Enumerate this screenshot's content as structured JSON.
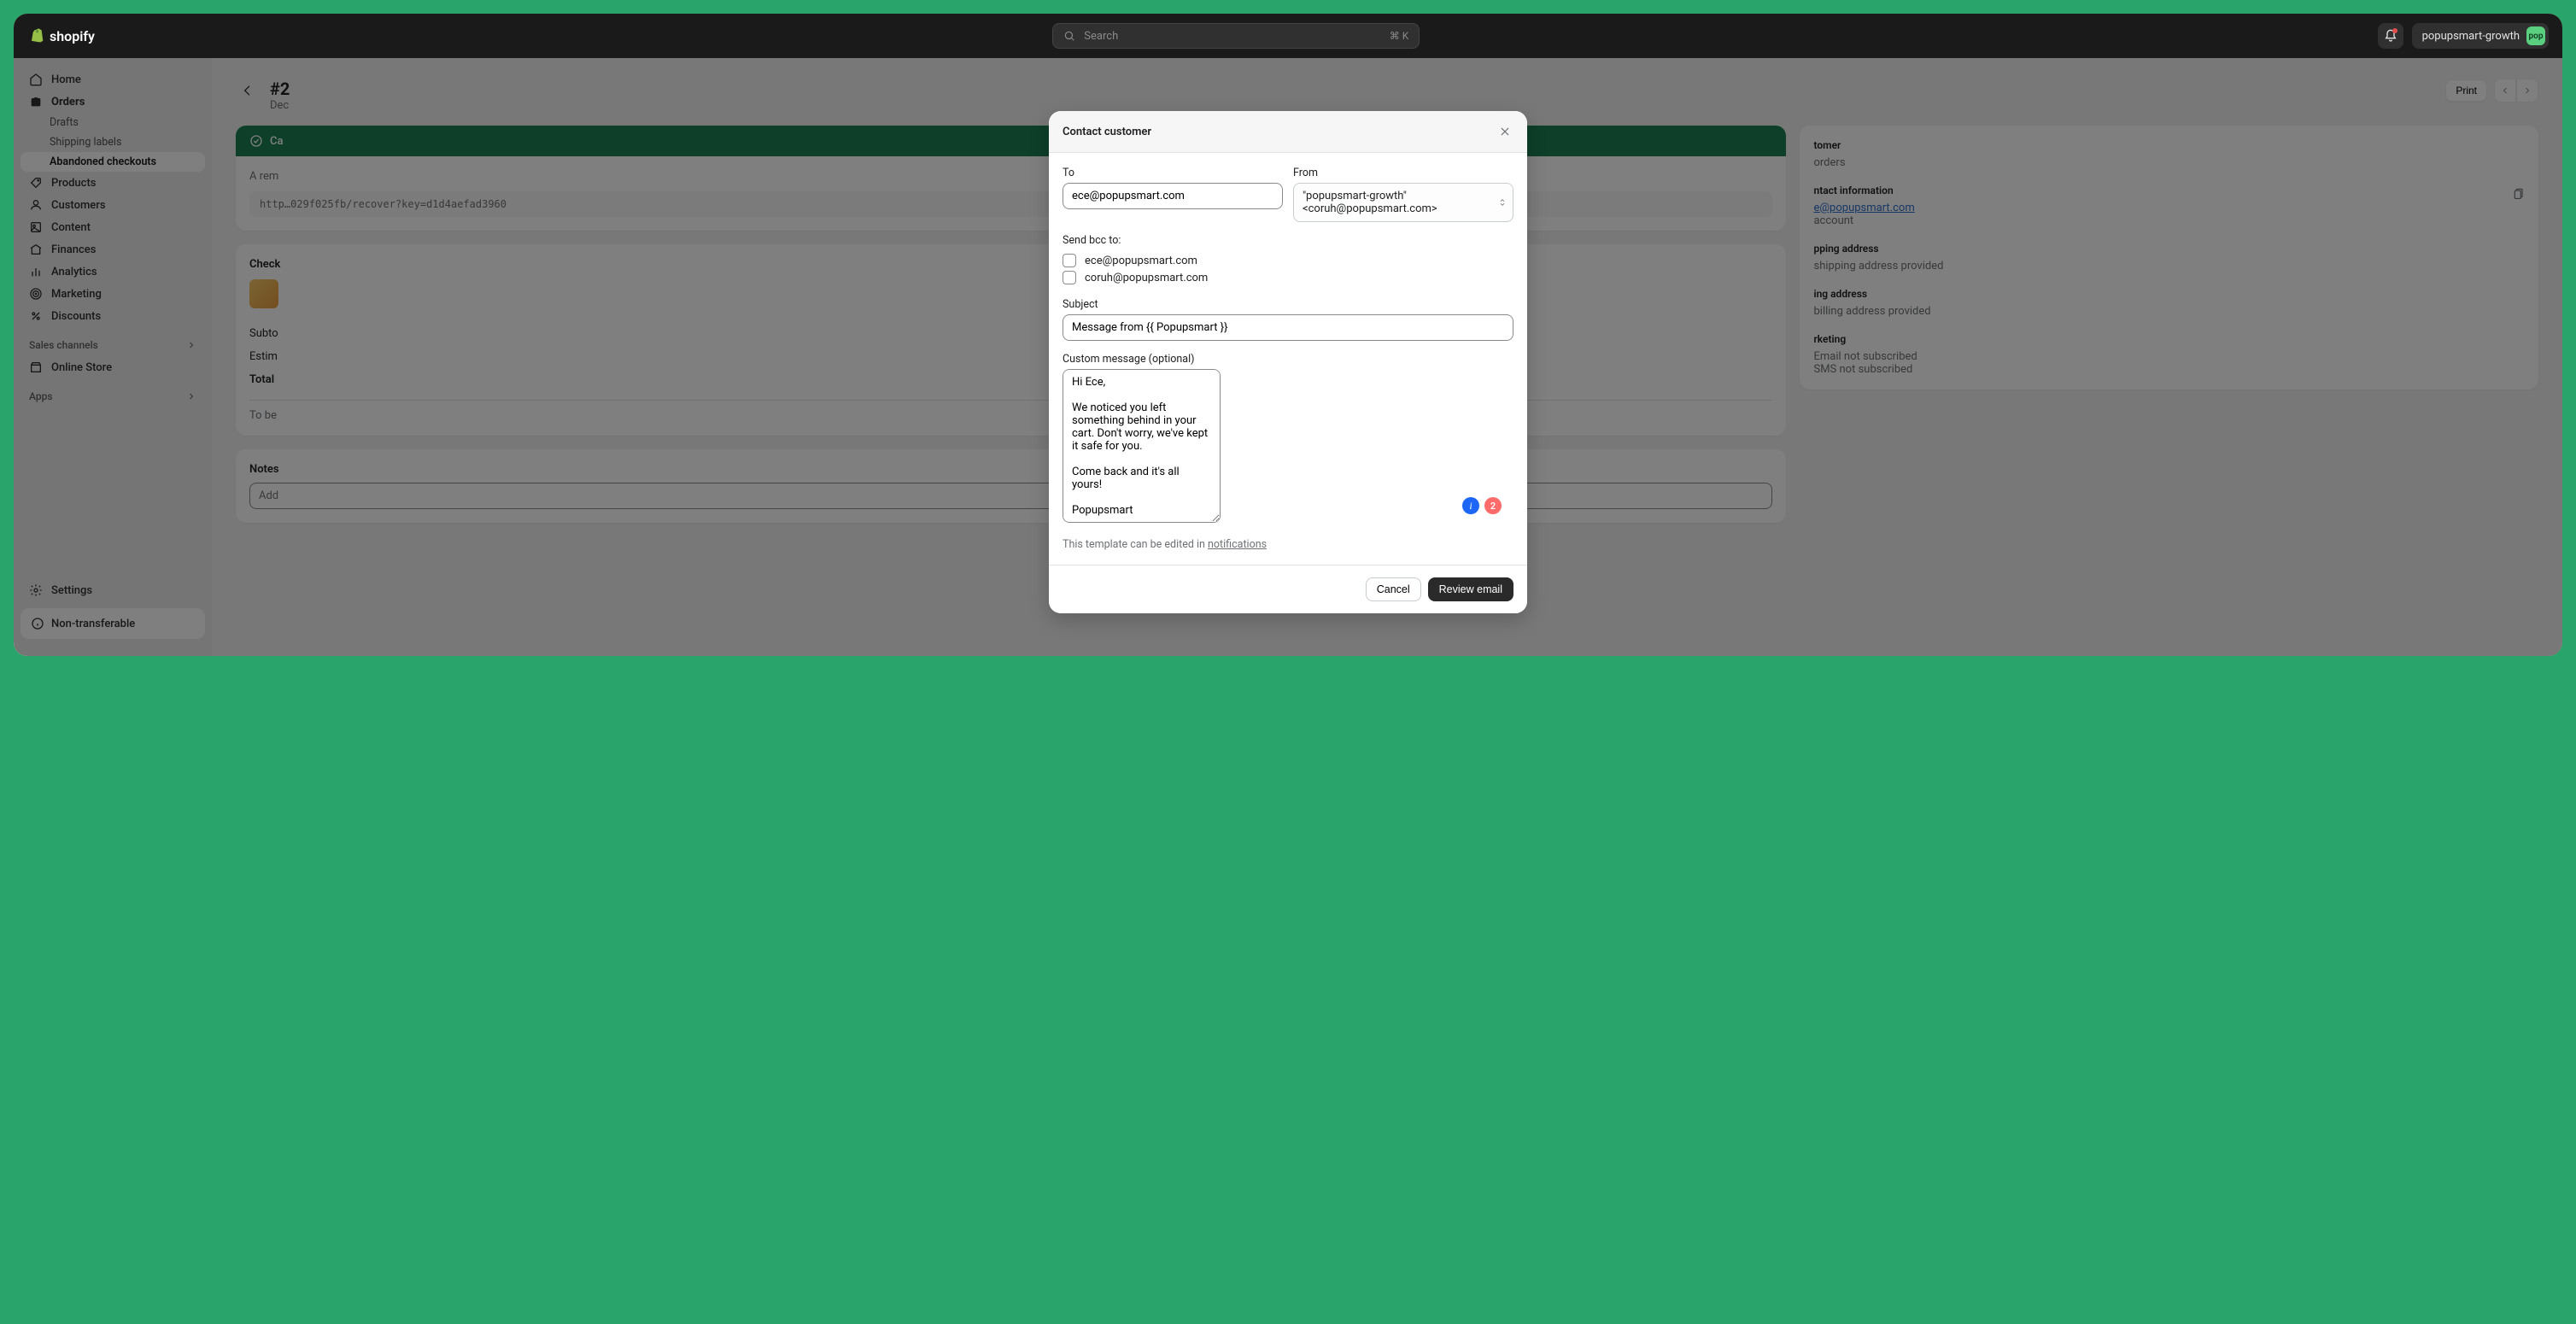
{
  "topbar": {
    "brand": "shopify",
    "search_placeholder": "Search",
    "kbd": "⌘ K",
    "account_name": "popupsmart-growth",
    "avatar_text": "pop"
  },
  "sidebar": {
    "items": [
      {
        "label": "Home"
      },
      {
        "label": "Orders"
      },
      {
        "label": "Products"
      },
      {
        "label": "Customers"
      },
      {
        "label": "Content"
      },
      {
        "label": "Finances"
      },
      {
        "label": "Analytics"
      },
      {
        "label": "Marketing"
      },
      {
        "label": "Discounts"
      }
    ],
    "orders_sub": [
      {
        "label": "Drafts"
      },
      {
        "label": "Shipping labels"
      },
      {
        "label": "Abandoned checkouts"
      }
    ],
    "sales_channels_label": "Sales channels",
    "online_store_label": "Online Store",
    "apps_label": "Apps",
    "settings_label": "Settings",
    "non_transferable": "Non-transferable"
  },
  "page": {
    "title_prefix": "#2",
    "date_prefix": "Dec",
    "print_label": "Print",
    "recovery_banner": "Ca",
    "reminder_text": "A rem",
    "url_prefix": "http",
    "url_suffix": "029f025fb/recover?key=d1d4aefad3960",
    "checkout_label": "Check",
    "subtotal_label": "Subto",
    "estimated_label": "Estim",
    "total_label": "Total",
    "to_be_label": "To be",
    "notes_label": "Notes",
    "add_placeholder": "Add"
  },
  "right_panel": {
    "customer_heading": "tomer",
    "orders_text": "orders",
    "contact_heading": "ntact information",
    "email_link": "e@popupsmart.com",
    "account_text": "account",
    "shipping_heading": "pping address",
    "shipping_text": "shipping address provided",
    "billing_heading": "ing address",
    "billing_text": "billing address provided",
    "marketing_heading": "rketing",
    "marketing_email": "Email not subscribed",
    "marketing_sms": "SMS not subscribed"
  },
  "modal": {
    "title": "Contact customer",
    "to_label": "To",
    "to_value": "ece@popupsmart.com",
    "from_label": "From",
    "from_value": "\"popupsmart-growth\" <coruh@popupsmart.com>",
    "bcc_label": "Send bcc to:",
    "bcc_options": [
      "ece@popupsmart.com",
      "coruh@popupsmart.com"
    ],
    "subject_label": "Subject",
    "subject_value": "Message from {{ Popupsmart }}",
    "body_label": "Custom message (optional)",
    "body_value": "Hi Ece,\n\nWe noticed you left something behind in your cart. Don't worry, we've kept it safe for you.\n\nCome back and it's all yours!\n\nPopupsmart",
    "hint_prefix": "This template can be edited in ",
    "hint_link": "notifications",
    "cancel_label": "Cancel",
    "review_label": "Review email",
    "badge_count": "2"
  }
}
